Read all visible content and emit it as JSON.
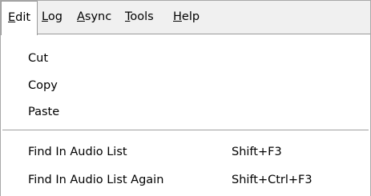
{
  "menubar": {
    "items": [
      {
        "accel": "E",
        "rest": "dit"
      },
      {
        "accel": "L",
        "rest": "og"
      },
      {
        "accel": "A",
        "rest": "sync"
      },
      {
        "accel": "T",
        "rest": "ools"
      },
      {
        "accel": "H",
        "rest": "elp"
      }
    ]
  },
  "edit_menu": {
    "items": [
      {
        "label": "Cut",
        "shortcut": ""
      },
      {
        "label": "Copy",
        "shortcut": ""
      },
      {
        "label": "Paste",
        "shortcut": ""
      },
      {
        "label": "Find In Audio List",
        "shortcut": "Shift+F3"
      },
      {
        "label": "Find In Audio List Again",
        "shortcut": "Shift+Ctrl+F3"
      }
    ]
  }
}
